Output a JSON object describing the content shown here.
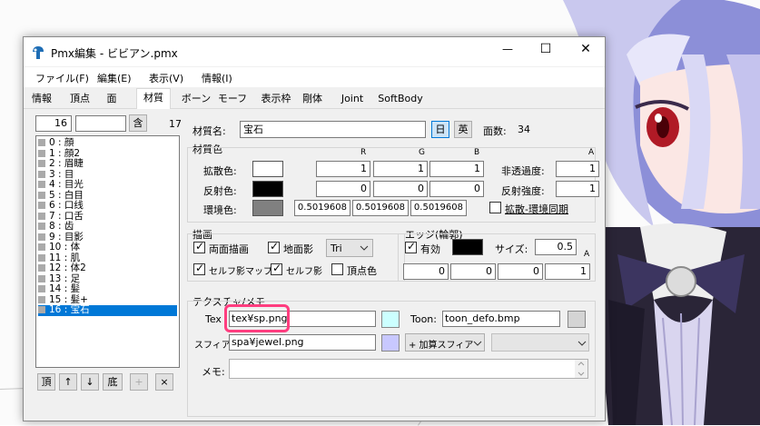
{
  "window": {
    "title": "Pmx編集 - ビビアン.pmx",
    "controls": {
      "minimize": "—",
      "maximize": "☐",
      "close": "✕"
    }
  },
  "menu": [
    "ファイル(F)",
    "編集(E)",
    "表示(V)",
    "情報(I)"
  ],
  "tabs": [
    "情報",
    "頂点",
    "面",
    "材質",
    "ボーン",
    "モーフ",
    "表示枠",
    "剛体",
    "Joint",
    "SoftBody"
  ],
  "active_tab": "材質",
  "list": {
    "index_value": "16",
    "include_button": "含",
    "count": "17",
    "items": [
      "0 : 顔",
      "1 : 顔2",
      "2 : 眉睫",
      "3 : 目",
      "4 : 目光",
      "5 : 白目",
      "6 : 口线",
      "7 : 口舌",
      "8 : 齿",
      "9 : 目影",
      "10 : 体",
      "11 : 肌",
      "12 : 体2",
      "13 : 足",
      "14 : 髪",
      "15 : 髪+",
      "16 : 宝石"
    ],
    "selected_index": 16,
    "buttons": [
      "頂",
      "↑",
      "↓",
      "底",
      "+",
      "×"
    ]
  },
  "material": {
    "name_label": "材質名:",
    "name": "宝石",
    "jp_button": "日",
    "en_button": "英",
    "face_count_label": "面数:",
    "face_count": "34",
    "color_group": "材質色",
    "col_r": "R",
    "col_g": "G",
    "col_b": "B",
    "col_a": "A",
    "diffuse_label": "拡散色:",
    "diffuse": [
      "1",
      "1",
      "1"
    ],
    "diffuse_swatch": "#ffffff",
    "alpha_label": "非透過度:",
    "alpha": "1",
    "specular_label": "反射色:",
    "specular": [
      "0",
      "0",
      "0"
    ],
    "specular_swatch": "#000000",
    "specular_power_label": "反射強度:",
    "specular_power": "1",
    "ambient_label": "環境色:",
    "ambient": [
      "0.5019608",
      "0.5019608",
      "0.5019608"
    ],
    "ambient_swatch": "#808080",
    "sync_label": "拡散-環境同期"
  },
  "draw": {
    "group": "描画",
    "double_sided": "両面描画",
    "ground_shadow": "地面影",
    "tri_select": "Tri",
    "self_shadow_map": "セルフ影マップ",
    "self_shadow": "セルフ影",
    "vertex_color": "頂点色"
  },
  "edge": {
    "group": "エッジ(輪郭)",
    "enabled": "有効",
    "swatch": "#000000",
    "size_label": "サイズ:",
    "size": "0.5",
    "a_label": "A",
    "rgba": [
      "0",
      "0",
      "0",
      "1"
    ]
  },
  "texture": {
    "group": "テクスチャ/メモ",
    "tex_label": "Tex",
    "tex": "tex¥sp.png",
    "tex_swatch": "#ccffff",
    "toon_label": "Toon:",
    "toon": "toon_defo.bmp",
    "toon_swatch": "#d4d4d4",
    "sphere_label": "スフィア:",
    "sphere": "spa¥jewel.png",
    "sphere_swatch": "#c8c8ff",
    "sphere_mode": "+ 加算スフィア",
    "memo_label": "メモ:"
  },
  "colors": {
    "highlight": "#ff3d7f",
    "selection": "#0078d7"
  }
}
